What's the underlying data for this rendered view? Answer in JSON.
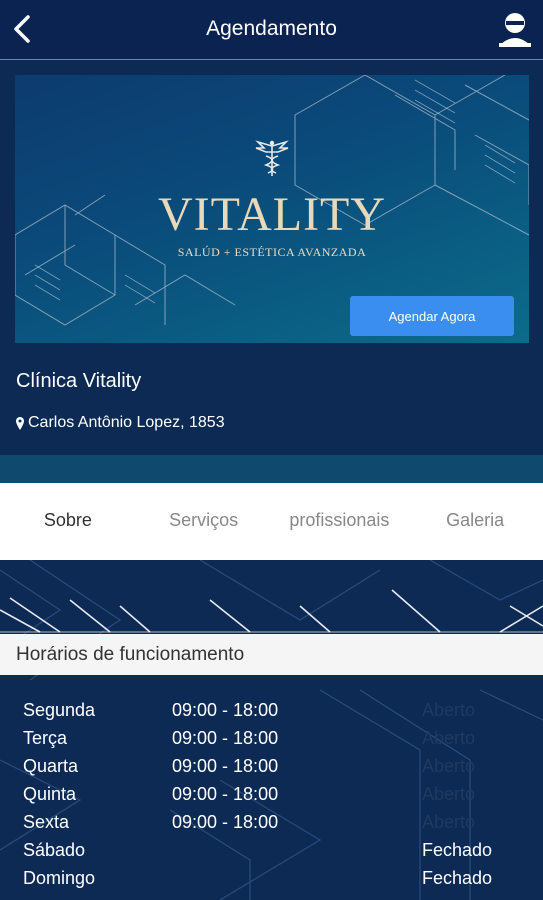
{
  "header": {
    "title": "Agendamento"
  },
  "banner": {
    "brand": "VITALITY",
    "tagline": "SALÚD + ESTÉTICA AVANZADA",
    "book_button": "Agendar Agora"
  },
  "clinic": {
    "name": "Clínica Vitality",
    "address": "Carlos Antônio Lopez, 1853"
  },
  "tabs": [
    {
      "label": "Sobre"
    },
    {
      "label": "Serviços"
    },
    {
      "label": "profissionais"
    },
    {
      "label": "Galeria"
    }
  ],
  "hours_section": {
    "title": "Horários de funcionamento",
    "rows": [
      {
        "day": "Segunda",
        "time": "09:00 - 18:00",
        "status": "Aberto"
      },
      {
        "day": "Terça",
        "time": "09:00 - 18:00",
        "status": "Aberto"
      },
      {
        "day": "Quarta",
        "time": "09:00 - 18:00",
        "status": "Aberto"
      },
      {
        "day": "Quinta",
        "time": "09:00 - 18:00",
        "status": "Aberto"
      },
      {
        "day": "Sexta",
        "time": "09:00 - 18:00",
        "status": "Aberto"
      },
      {
        "day": "Sábado",
        "time": "",
        "status": "Fechado"
      },
      {
        "day": "Domingo",
        "time": "",
        "status": "Fechado"
      }
    ]
  },
  "colors": {
    "background": "#0d2a55",
    "accent_button": "#3a8ef0",
    "brand_gold": "#ead9b8"
  },
  "icons": {
    "back": "chevron-left-icon",
    "user": "user-icon",
    "location": "map-pin-icon",
    "logo": "caduceus-icon"
  }
}
